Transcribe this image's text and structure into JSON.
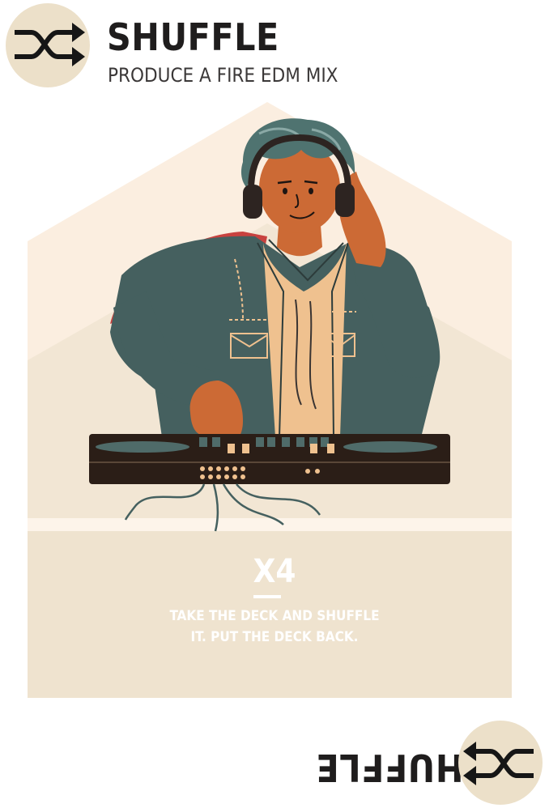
{
  "card": {
    "title": "SHUFFLE",
    "subtitle": "PRODUCE A FIRE EDM MIX",
    "multiplier": "X4",
    "instruction_line1": "TAKE THE DECK AND SHUFFLE",
    "instruction_line2": "IT. PUT THE DECK BACK.",
    "bottom_title": "SHUFFLE"
  },
  "icons": {
    "top": "shuffle-icon",
    "bottom": "shuffle-icon"
  },
  "colors": {
    "badge": "#ece0c9",
    "panel_light": "#fbeee0",
    "panel_mid": "#f0e4d2",
    "jacket": "#45605f",
    "skin": "#cc6a35",
    "hoodie": "#efc18f",
    "deck": "#2b1e17",
    "text_dark": "#1f1d1d"
  }
}
